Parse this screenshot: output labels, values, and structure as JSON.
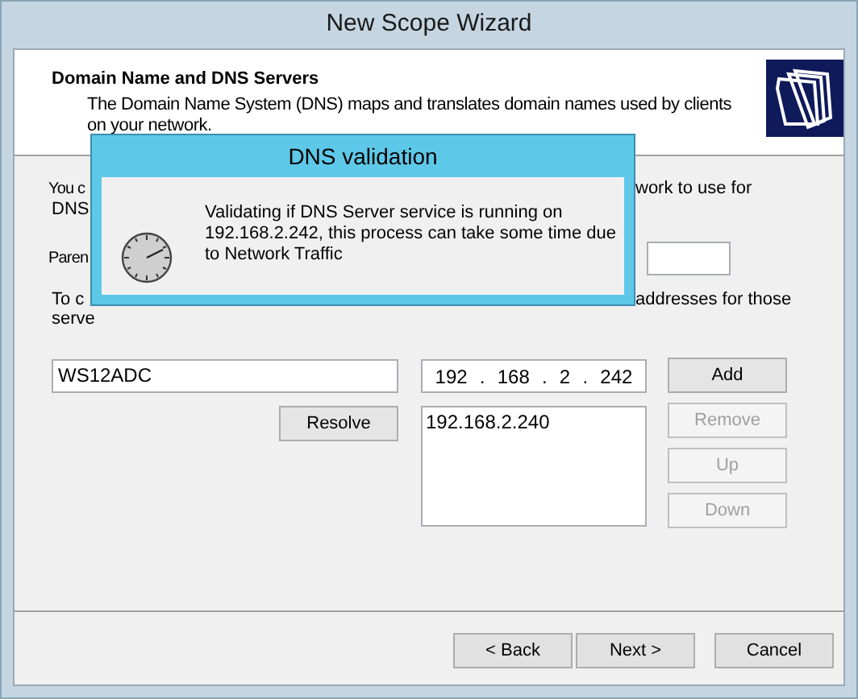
{
  "window": {
    "title": "New Scope Wizard"
  },
  "header": {
    "title": "Domain Name and DNS Servers",
    "description": "The Domain Name System (DNS) maps and translates domain names used by clients on your network."
  },
  "intro_line_1": {
    "start": "You c",
    "end": "work to use for"
  },
  "intro_line_2": "DNS",
  "parent_label": "Paren",
  "servers_line_1": {
    "start": "To c",
    "end": "addresses for those"
  },
  "servers_line_2": "serve",
  "server_name": {
    "value": "WS12ADC"
  },
  "resolve_button": {
    "label": "Resolve"
  },
  "ip_address": {
    "octets": [
      "192",
      "168",
      "2",
      "242"
    ],
    "separators": [
      ".",
      ".",
      "."
    ]
  },
  "ip_list": {
    "items": [
      "192.168.2.240"
    ]
  },
  "list_buttons": [
    {
      "label": "Add",
      "disabled": false
    },
    {
      "label": "Remove",
      "disabled": true
    },
    {
      "label": "Up",
      "disabled": true
    },
    {
      "label": "Down",
      "disabled": true
    }
  ],
  "footer_buttons": [
    {
      "label": "< Back"
    },
    {
      "label": "Next >"
    },
    {
      "label": "Cancel"
    }
  ],
  "dialog": {
    "title": "DNS validation",
    "message_lines": [
      "Validating if DNS Server service is running on",
      "192.168.2.242, this process can take some time due",
      "to Network Traffic"
    ]
  }
}
